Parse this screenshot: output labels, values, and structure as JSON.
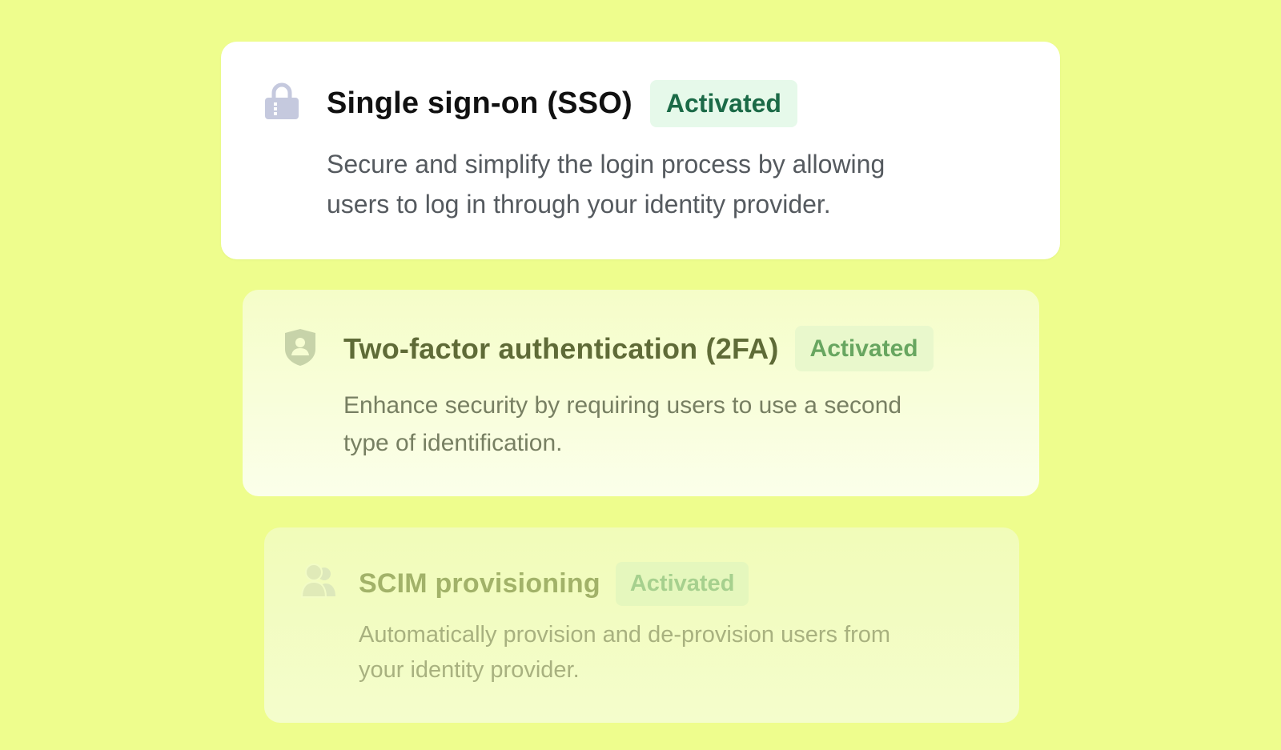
{
  "background_color": "#eefd8d",
  "features": [
    {
      "icon": "lock-icon",
      "title": "Single sign-on (SSO)",
      "status": "Activated",
      "description_lines": [
        "Secure and simplify the login process by allowing",
        "users to log in through your identity provider."
      ]
    },
    {
      "icon": "shield-user-icon",
      "title": "Two-factor authentication (2FA)",
      "status": "Activated",
      "description_lines": [
        "Enhance security by requiring users to use a second",
        "type of identification."
      ]
    },
    {
      "icon": "users-icon",
      "title": "SCIM provisioning",
      "status": "Activated",
      "description_lines": [
        "Automatically provision and de-provision users from",
        "your identity provider."
      ]
    }
  ],
  "colors": {
    "badge_text": "#1b6a47",
    "badge_background": "#e6f9ea",
    "icon": "#c5c9de"
  }
}
